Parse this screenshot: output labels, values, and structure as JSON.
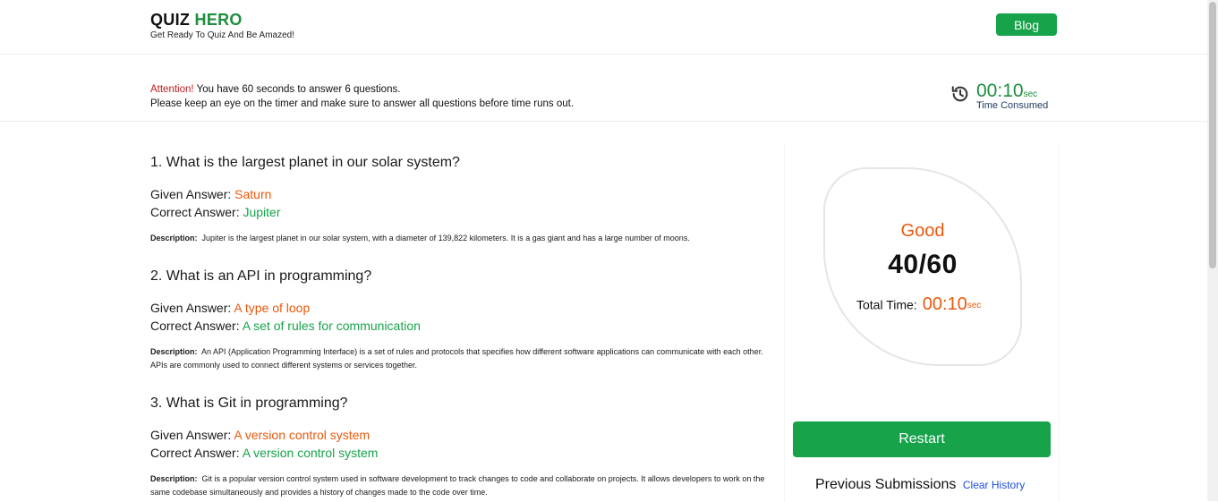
{
  "brand": {
    "title_main": "QUIZ",
    "title_accent": "HERO",
    "tagline": "Get Ready To Quiz And Be Amazed!"
  },
  "nav": {
    "blog_label": "Blog"
  },
  "notice": {
    "attention": "Attention!",
    "line1": "You have 60 seconds to answer 6 questions.",
    "line2": "Please keep an eye on the timer and make sure to answer all questions before time runs out."
  },
  "timer": {
    "icon": "history-icon",
    "value": "00:10",
    "unit": "sec",
    "label": "Time Consumed"
  },
  "questions": [
    {
      "title": "1. What is the largest planet in our solar system?",
      "given_label": "Given Answer:",
      "given": "Saturn",
      "correct_label": "Correct Answer:",
      "correct": "Jupiter",
      "desc_label": "Description:",
      "desc": "Jupiter is the largest planet in our solar system, with a diameter of 139,822 kilometers. It is a gas giant and has a large number of moons."
    },
    {
      "title": "2. What is an API in programming?",
      "given_label": "Given Answer:",
      "given": "A type of loop",
      "correct_label": "Correct Answer:",
      "correct": "A set of rules for communication",
      "desc_label": "Description:",
      "desc": "An API (Application Programming Interface) is a set of rules and protocols that specifies how different software applications can communicate with each other. APIs are commonly used to connect different systems or services together."
    },
    {
      "title": "3. What is Git in programming?",
      "given_label": "Given Answer:",
      "given": "A version control system",
      "correct_label": "Correct Answer:",
      "correct": "A version control system",
      "desc_label": "Description:",
      "desc": "Git is a popular version control system used in software development to track changes to code and collaborate on projects. It allows developers to work on the same codebase simultaneously and provides a history of changes made to the code over time."
    }
  ],
  "result": {
    "rating": "Good",
    "score": "40/60",
    "total_time_label": "Total Time:",
    "total_time_value": "00:10",
    "total_time_unit": "sec",
    "restart_label": "Restart",
    "previous_label": "Previous Submissions",
    "clear_label": "Clear History"
  },
  "colors": {
    "brand_green": "#16a34a",
    "accent_orange": "#ea580c",
    "attention_red": "#b91c1c",
    "link_blue": "#1d4ed8"
  }
}
